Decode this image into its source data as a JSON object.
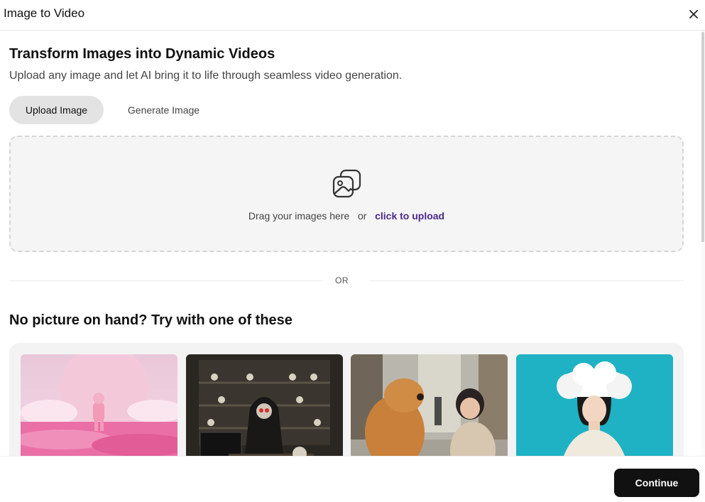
{
  "dialog": {
    "title": "Image to Video",
    "close_icon": "close-icon"
  },
  "intro": {
    "headline": "Transform Images into Dynamic Videos",
    "subline": "Upload any image and let AI bring it to life through seamless video generation."
  },
  "tabs": [
    {
      "label": "Upload Image",
      "active": true
    },
    {
      "label": "Generate Image",
      "active": false
    }
  ],
  "dropzone": {
    "icon": "images-icon",
    "text": "Drag your images here",
    "or": "or",
    "link": "click to upload"
  },
  "divider": {
    "label": "OR"
  },
  "samples": {
    "heading": "No picture on hand? Try with one of these",
    "items": [
      {
        "name": "astronaut-flower-field"
      },
      {
        "name": "skeleton-reaper-desk"
      },
      {
        "name": "dog-and-girl-street"
      },
      {
        "name": "girl-cloud-hair"
      }
    ]
  },
  "footer": {
    "continue_label": "Continue"
  },
  "colors": {
    "accent_link": "#4a2a8a",
    "primary_button": "#111111",
    "tab_active_bg": "#e3e3e3"
  }
}
